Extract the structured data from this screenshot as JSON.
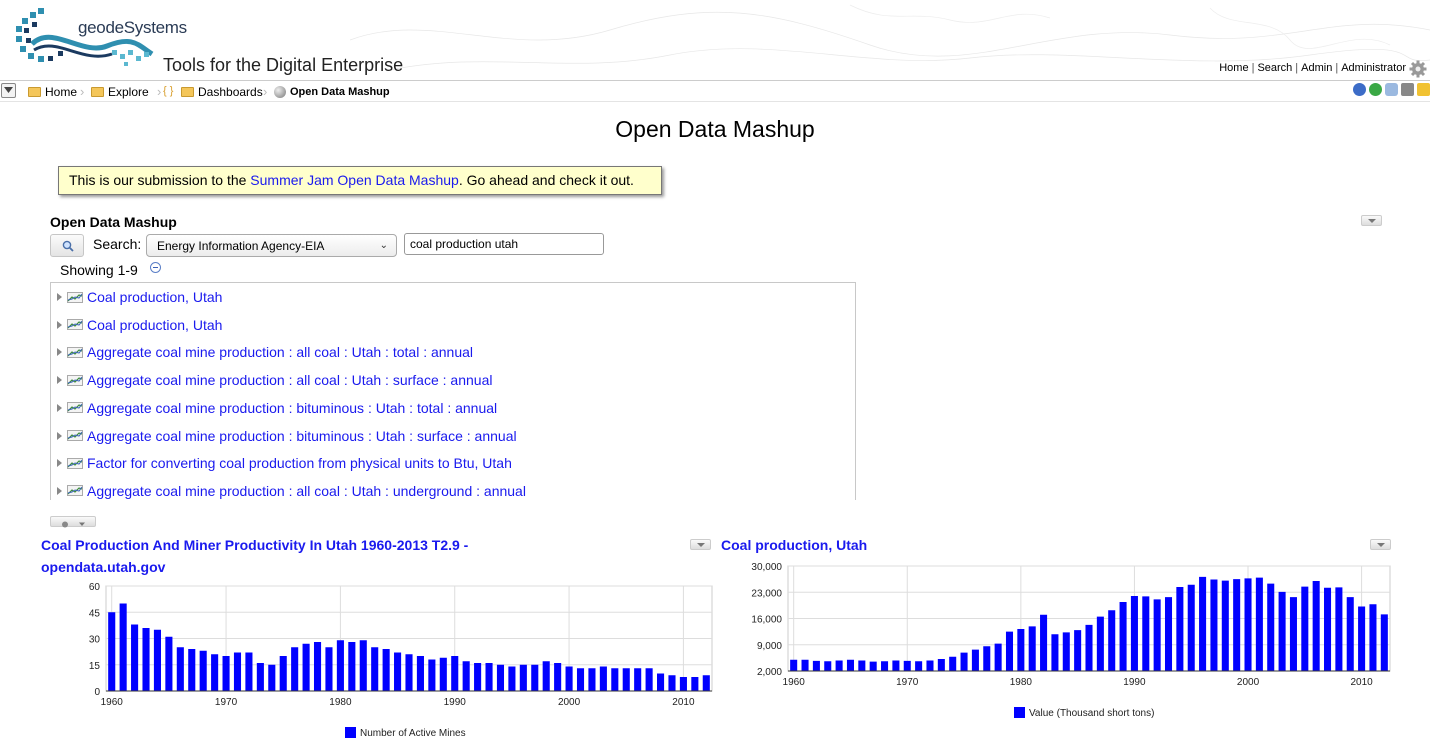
{
  "brand": {
    "name": "geodeSystems",
    "tagline": "Tools for the Digital Enterprise"
  },
  "toplinks": [
    "Home",
    "Search",
    "Admin",
    "Administrator"
  ],
  "breadcrumb": [
    {
      "label": "Home"
    },
    {
      "label": "Explore"
    },
    {
      "label": "Dashboards"
    },
    {
      "label": "Open Data Mashup"
    }
  ],
  "page": {
    "title": "Open Data Mashup"
  },
  "note": {
    "prefix": "This is our submission to the ",
    "link": "Summer Jam Open Data Mashup",
    "suffix": ". Go ahead and check it out."
  },
  "mashup": {
    "title": "Open Data Mashup",
    "search_label": "Search:",
    "source": "Energy Information Agency-EIA",
    "query": "coal production utah",
    "showing": "Showing 1-9",
    "results": [
      "Coal production, Utah",
      "Coal production, Utah",
      "Aggregate coal mine production : all coal : Utah : total : annual",
      "Aggregate coal mine production : all coal : Utah : surface : annual",
      "Aggregate coal mine production : bituminous : Utah : total : annual",
      "Aggregate coal mine production : bituminous : Utah : surface : annual",
      "Factor for converting coal production from physical units to Btu, Utah",
      "Aggregate coal mine production : all coal : Utah : underground : annual"
    ]
  },
  "colors": {
    "link": "#1a1aee",
    "bar": "#0000ff",
    "note_bg": "#ffffcc"
  },
  "chart_data": [
    {
      "type": "bar",
      "title": "Coal Production And Miner Productivity In Utah 1960-2013 T2.9 - opendata.utah.gov",
      "title_lines": [
        "Coal Production And Miner Productivity In Utah 1960-2013 T2.9 -",
        "opendata.utah.gov"
      ],
      "x": [
        1960,
        1961,
        1962,
        1963,
        1964,
        1965,
        1966,
        1967,
        1968,
        1969,
        1970,
        1971,
        1972,
        1973,
        1974,
        1975,
        1976,
        1977,
        1978,
        1979,
        1980,
        1981,
        1982,
        1983,
        1984,
        1985,
        1986,
        1987,
        1988,
        1989,
        1990,
        1991,
        1992,
        1993,
        1994,
        1995,
        1996,
        1997,
        1998,
        1999,
        2000,
        2001,
        2002,
        2003,
        2004,
        2005,
        2006,
        2007,
        2008,
        2009,
        2010,
        2011,
        2012
      ],
      "series": [
        {
          "name": "Number of Active Mines",
          "values": [
            45,
            50,
            38,
            36,
            35,
            31,
            25,
            24,
            23,
            21,
            20,
            22,
            22,
            16,
            15,
            20,
            25,
            27,
            28,
            25,
            29,
            28,
            29,
            25,
            24,
            22,
            21,
            20,
            18,
            19,
            20,
            17,
            16,
            16,
            15,
            14,
            15,
            15,
            17,
            16,
            14,
            13,
            13,
            14,
            13,
            13,
            13,
            13,
            10,
            9,
            8,
            8,
            9
          ]
        }
      ],
      "ylim": [
        0,
        60
      ],
      "yticks": [
        "0",
        "15",
        "30",
        "45",
        "60"
      ],
      "xticks": [
        "1960",
        "1970",
        "1980",
        "1990",
        "2000",
        "2010"
      ],
      "grid": true,
      "legend": "bottom"
    },
    {
      "type": "bar",
      "title": "Coal production, Utah",
      "x": [
        1960,
        1961,
        1962,
        1963,
        1964,
        1965,
        1966,
        1967,
        1968,
        1969,
        1970,
        1971,
        1972,
        1973,
        1974,
        1975,
        1976,
        1977,
        1978,
        1979,
        1980,
        1981,
        1982,
        1983,
        1984,
        1985,
        1986,
        1987,
        1988,
        1989,
        1990,
        1991,
        1992,
        1993,
        1994,
        1995,
        1996,
        1997,
        1998,
        1999,
        2000,
        2001,
        2002,
        2003,
        2004,
        2005,
        2006,
        2007,
        2008,
        2009,
        2010,
        2011,
        2012
      ],
      "series": [
        {
          "name": "Value (Thousand short tons)",
          "values": [
            5000,
            5000,
            4700,
            4600,
            4800,
            5000,
            4800,
            4500,
            4600,
            4800,
            4700,
            4600,
            4800,
            5200,
            5800,
            6900,
            7700,
            8600,
            9300,
            12500,
            13200,
            13900,
            17000,
            11800,
            12300,
            12900,
            14300,
            16500,
            18200,
            20400,
            22000,
            21900,
            21100,
            21700,
            24400,
            25000,
            27100,
            26400,
            26100,
            26500,
            26700,
            26900,
            25300,
            23100,
            21700,
            24500,
            26000,
            24200,
            24300,
            21700,
            19200,
            19800,
            17100
          ]
        }
      ],
      "ylim": [
        2000,
        30000
      ],
      "yticks": [
        "2,000",
        "9,000",
        "16,000",
        "23,000",
        "30,000"
      ],
      "xticks": [
        "1960",
        "1970",
        "1980",
        "1990",
        "2000",
        "2010"
      ],
      "grid": true,
      "legend": "bottom"
    }
  ]
}
